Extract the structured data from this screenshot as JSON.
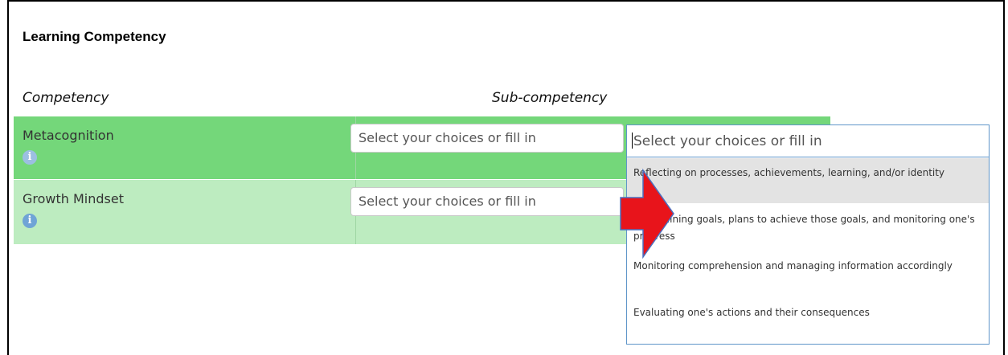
{
  "section": {
    "title": "Learning Competency"
  },
  "columns": {
    "competency": "Competency",
    "sub_competency": "Sub-competency"
  },
  "rows": [
    {
      "competency": "Metacognition",
      "info_icon": "info-icon",
      "select_placeholder": "Select your choices or fill in"
    },
    {
      "competency": "Growth Mindset",
      "info_icon": "info-icon",
      "select_placeholder": "Select your choices or fill in"
    }
  ],
  "dropdown": {
    "input_placeholder": "Select your choices or fill in",
    "options": [
      "Reflecting on processes, achievements, learning, and/or identity",
      "Determining goals, plans to achieve those goals, and monitoring one's progress",
      "Monitoring comprehension and managing information accordingly",
      "Evaluating one's actions and their consequences"
    ]
  },
  "colors": {
    "row_active": "#74d77a",
    "row_inactive": "#bdecc0",
    "dropdown_border": "#5f95c9",
    "highlight": "#e3e3e3",
    "arrow": "#e8141b"
  }
}
